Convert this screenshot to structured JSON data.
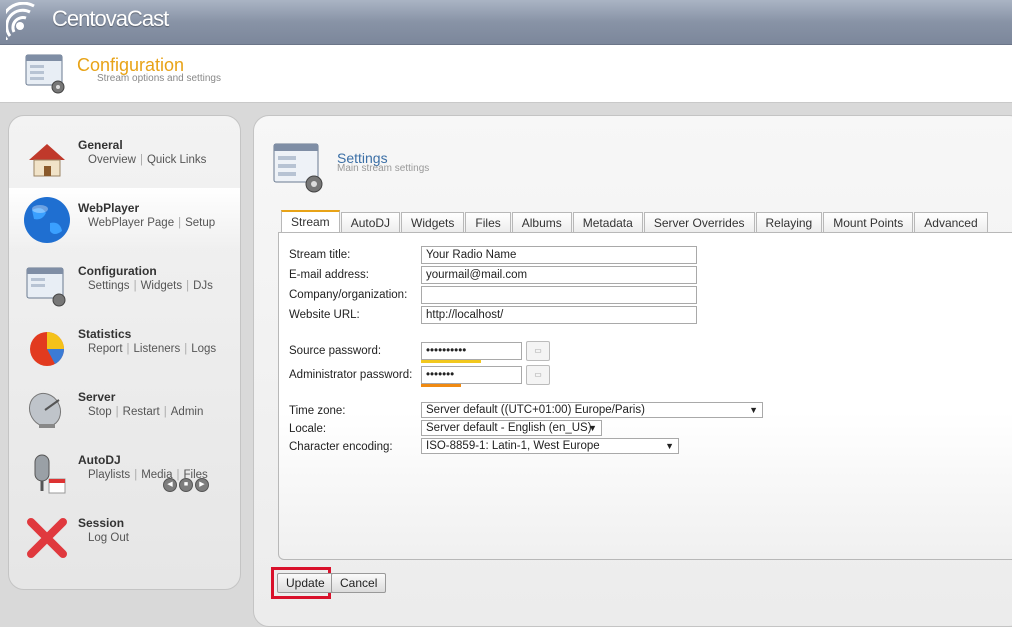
{
  "app": {
    "brand": "CentovaCast"
  },
  "header": {
    "title": "Configuration",
    "subtitle": "Stream options and settings"
  },
  "sidebar": {
    "items": [
      {
        "title": "General",
        "links": [
          "Overview",
          "Quick Links"
        ],
        "icon": "house-icon"
      },
      {
        "title": "WebPlayer",
        "links": [
          "WebPlayer Page",
          "Setup"
        ],
        "icon": "globe-icon"
      },
      {
        "title": "Configuration",
        "links": [
          "Settings",
          "Widgets",
          "DJs"
        ],
        "icon": "config-window-icon"
      },
      {
        "title": "Statistics",
        "links": [
          "Report",
          "Listeners",
          "Logs"
        ],
        "icon": "pie-chart-icon"
      },
      {
        "title": "Server",
        "links": [
          "Stop",
          "Restart",
          "Admin"
        ],
        "icon": "satellite-dish-icon"
      },
      {
        "title": "AutoDJ",
        "links": [
          "Playlists",
          "Media",
          "Files"
        ],
        "icon": "microphone-icon"
      },
      {
        "title": "Session",
        "links": [
          "Log Out"
        ],
        "icon": "red-x-icon"
      }
    ]
  },
  "section": {
    "title": "Settings",
    "subtitle": "Main stream settings"
  },
  "tabs": [
    "Stream",
    "AutoDJ",
    "Widgets",
    "Files",
    "Albums",
    "Metadata",
    "Server Overrides",
    "Relaying",
    "Mount Points",
    "Advanced"
  ],
  "form": {
    "stream_title": {
      "label": "Stream title:",
      "value": "Your Radio Name"
    },
    "email": {
      "label": "E-mail address:",
      "value": "yourmail@mail.com"
    },
    "company": {
      "label": "Company/organization:",
      "value": ""
    },
    "website": {
      "label": "Website URL:",
      "value": "http://localhost/"
    },
    "source_password": {
      "label": "Source password:",
      "value": "••••••••••",
      "strength": 0.6
    },
    "admin_password": {
      "label": "Administrator password:",
      "value": "•••••••",
      "strength": 0.4
    },
    "timezone": {
      "label": "Time zone:",
      "value": "Server default ((UTC+01:00) Europe/Paris)"
    },
    "locale": {
      "label": "Locale:",
      "value": "Server default - English (en_US)"
    },
    "encoding": {
      "label": "Character encoding:",
      "value": "ISO-8859-1: Latin-1, West Europe"
    }
  },
  "buttons": {
    "update": "Update",
    "cancel": "Cancel"
  },
  "colors": {
    "accent": "#e8a317",
    "section_title": "#3b6fa6",
    "highlight": "#d9112b",
    "strength_yellow": "#f2c81e",
    "strength_orange": "#f08a12"
  }
}
